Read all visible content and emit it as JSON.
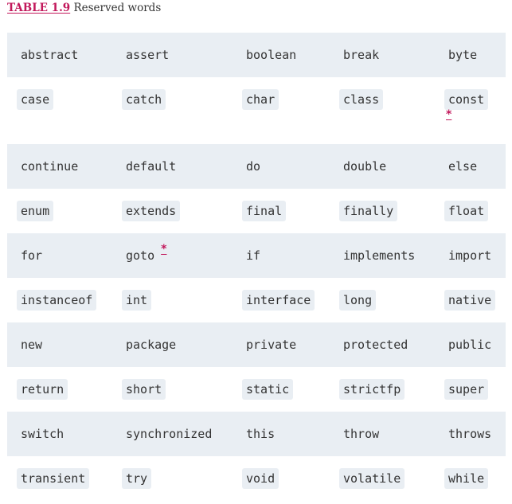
{
  "caption": {
    "number": "TABLE 1.9",
    "title": "Reserved words"
  },
  "rows": [
    [
      "abstract",
      "assert",
      "boolean",
      "break",
      "byte"
    ],
    [
      "case",
      "catch",
      "char",
      "class",
      "const"
    ],
    [
      "continue",
      "default",
      "do",
      "double",
      "else"
    ],
    [
      "enum",
      "extends",
      "final",
      "finally",
      "float"
    ],
    [
      "for",
      "goto",
      "if",
      "implements",
      "import"
    ],
    [
      "instanceof",
      "int",
      "interface",
      "long",
      "native"
    ],
    [
      "new",
      "package",
      "private",
      "protected",
      "public"
    ],
    [
      "return",
      "short",
      "static",
      "strictfp",
      "super"
    ],
    [
      "switch",
      "synchronized",
      "this",
      "throw",
      "throws"
    ],
    [
      "transient",
      "try",
      "void",
      "volatile",
      "while"
    ]
  ],
  "footnote_mark": "*"
}
